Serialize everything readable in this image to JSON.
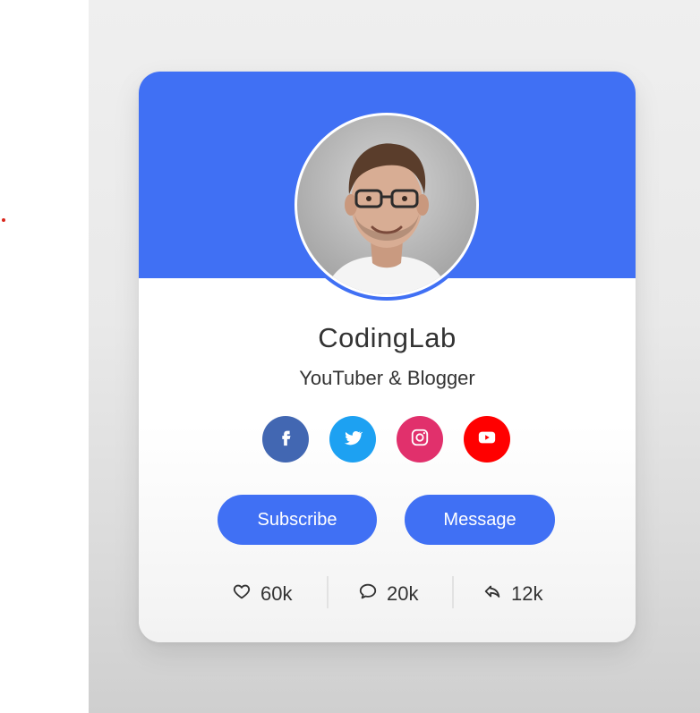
{
  "profile": {
    "name": "CodingLab",
    "role": "YouTuber & Blogger"
  },
  "social_links": [
    {
      "name": "facebook",
      "icon": "facebook-icon",
      "color": "#4267b2"
    },
    {
      "name": "twitter",
      "icon": "twitter-icon",
      "color": "#1da1f2"
    },
    {
      "name": "instagram",
      "icon": "instagram-icon",
      "color": "#e1306c"
    },
    {
      "name": "youtube",
      "icon": "youtube-icon",
      "color": "#ff0000"
    }
  ],
  "buttons": {
    "subscribe_label": "Subscribe",
    "message_label": "Message"
  },
  "stats": {
    "likes": {
      "value": "60k",
      "icon": "heart-icon"
    },
    "comments": {
      "value": "20k",
      "icon": "comment-icon"
    },
    "shares": {
      "value": "12k",
      "icon": "share-icon"
    }
  },
  "colors": {
    "accent": "#4070f4",
    "text": "#333333"
  }
}
